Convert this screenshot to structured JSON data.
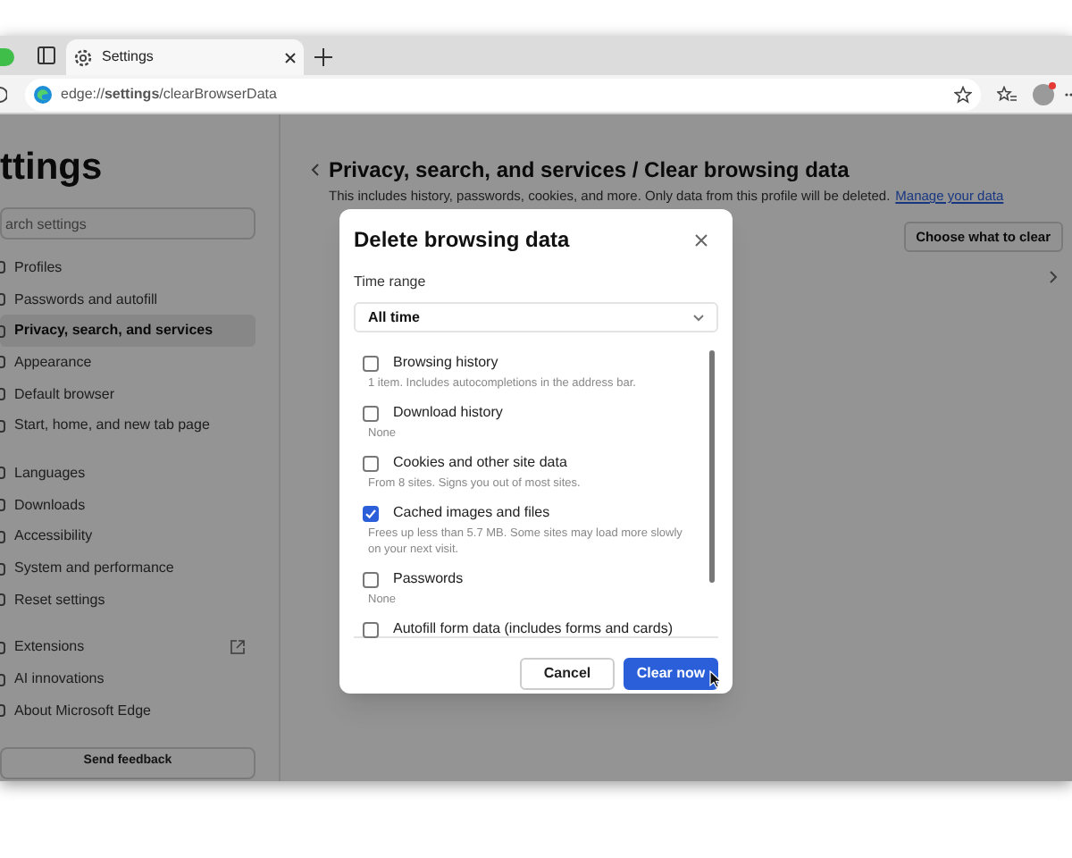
{
  "tab": {
    "title": "Settings",
    "selected": true
  },
  "address_bar": {
    "url": "edge://**settings**/clearBrowserData"
  },
  "sidebar": {
    "title": "ttings",
    "search": {
      "placeholder": "arch settings"
    },
    "groups": [
      [
        {
          "label": "Profiles",
          "selected": false
        },
        {
          "label": "Passwords and autofill",
          "selected": false
        },
        {
          "label": "Privacy, search, and services",
          "selected": true
        },
        {
          "label": "Appearance",
          "selected": false
        },
        {
          "label": "Default browser",
          "selected": false
        },
        {
          "label": "Start, home, and new tab page",
          "selected": false
        }
      ],
      [
        {
          "label": "Languages",
          "selected": false
        },
        {
          "label": "Downloads",
          "selected": false
        },
        {
          "label": "Accessibility",
          "selected": false
        },
        {
          "label": "System and performance",
          "selected": false
        },
        {
          "label": "Reset settings",
          "selected": false
        }
      ],
      [
        {
          "label": "Extensions",
          "selected": false,
          "external": true
        },
        {
          "label": "AI innovations",
          "selected": false
        },
        {
          "label": "About Microsoft Edge",
          "selected": false
        }
      ]
    ],
    "feedback_button": "Send feedback"
  },
  "main": {
    "breadcrumb": "Privacy, search, and services / Clear browsing data",
    "description": "This includes history, passwords, cookies, and more. Only data from this profile will be deleted.",
    "link": "Manage your data",
    "button": "Choose what to clear"
  },
  "dialog": {
    "title": "Delete browsing data",
    "time_range_label": "Time range",
    "time_range": "All time",
    "items": [
      {
        "label": "Browsing history",
        "detail": "1 item. Includes autocompletions in the address bar.",
        "checked": false
      },
      {
        "label": "Download history",
        "detail": "None",
        "checked": false
      },
      {
        "label": "Cookies and other site data",
        "detail": "From 8 sites. Signs you out of most sites.",
        "checked": false
      },
      {
        "label": "Cached images and files",
        "detail": "Frees up less than 5.7 MB. Some sites may load more slowly on your next visit.",
        "checked": true
      },
      {
        "label": "Passwords",
        "detail": "None",
        "checked": false
      },
      {
        "label": "Autofill form data (includes forms and cards)",
        "checked": false
      }
    ],
    "buttons": [
      {
        "label": "Cancel",
        "kind": "secondary"
      },
      {
        "label": "Clear now",
        "kind": "primary"
      }
    ]
  }
}
